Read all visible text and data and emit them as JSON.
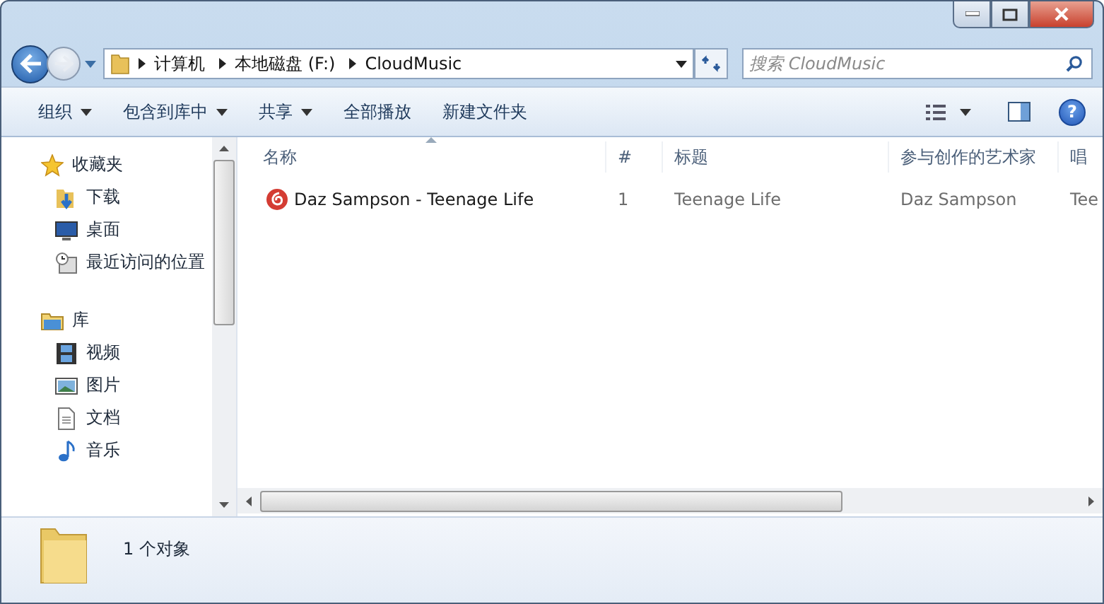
{
  "address": {
    "crumbs": [
      "计算机",
      "本地磁盘 (F:)",
      "CloudMusic"
    ]
  },
  "search": {
    "placeholder": "搜索 CloudMusic"
  },
  "toolbar": [
    {
      "label": "组织",
      "dropdown": true
    },
    {
      "label": "包含到库中",
      "dropdown": true
    },
    {
      "label": "共享",
      "dropdown": true
    },
    {
      "label": "全部播放",
      "dropdown": false
    },
    {
      "label": "新建文件夹",
      "dropdown": false
    }
  ],
  "help_button": "?",
  "sidebar": {
    "groups": [
      {
        "label": "收藏夹",
        "children": [
          {
            "label": "下载"
          },
          {
            "label": "桌面"
          },
          {
            "label": "最近访问的位置"
          }
        ]
      },
      {
        "label": "库",
        "children": [
          {
            "label": "视频"
          },
          {
            "label": "图片"
          },
          {
            "label": "文档"
          },
          {
            "label": "音乐"
          }
        ]
      }
    ]
  },
  "table": {
    "columns": [
      "名称",
      "#",
      "标题",
      "参与创作的艺术家",
      "唱"
    ],
    "rows": [
      [
        "Daz Sampson - Teenage Life",
        "1",
        "Teenage Life",
        "Daz Sampson",
        "Tee"
      ]
    ]
  },
  "status_bar": {
    "text": "1 个对象"
  }
}
